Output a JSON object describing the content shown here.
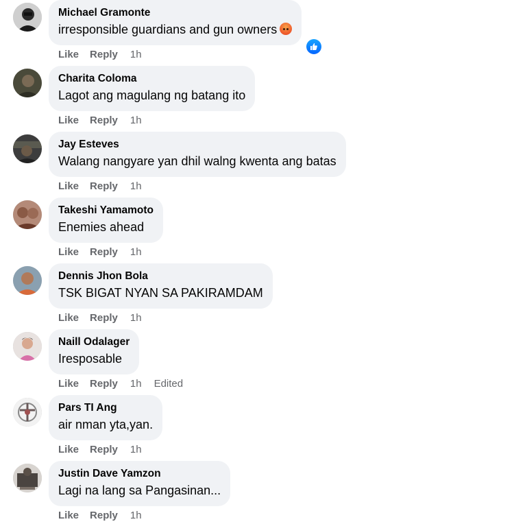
{
  "actions": {
    "like": "Like",
    "reply": "Reply"
  },
  "comments": [
    {
      "author": "Michael Gramonte",
      "text": "irresponsible guardians and gun owners",
      "emoji": "angry-emoji",
      "reaction": "like-icon",
      "time": "1h"
    },
    {
      "author": "Charita Coloma",
      "text": "Lagot ang magulang ng batang ito",
      "time": "1h"
    },
    {
      "author": "Jay Esteves",
      "text": "Walang nangyare yan dhil walng kwenta ang batas",
      "time": "1h"
    },
    {
      "author": "Takeshi Yamamoto",
      "text": "Enemies ahead",
      "time": "1h"
    },
    {
      "author": "Dennis Jhon Bola",
      "text": "TSK BIGAT NYAN SA PAKIRAMDAM",
      "time": "1h"
    },
    {
      "author": "Naill Odalager",
      "text": "Iresposable",
      "time": "1h",
      "edited": "Edited"
    },
    {
      "author": "Pars TI Ang",
      "text": "air nman yta,yan.",
      "time": "1h"
    },
    {
      "author": "Justin Dave Yamzon",
      "text": "Lagi na lang sa Pangasinan...",
      "time": "1h"
    }
  ],
  "colors": {
    "bubble": "#f0f2f5",
    "meta": "#65676b",
    "like_blue": "#1877f2"
  }
}
